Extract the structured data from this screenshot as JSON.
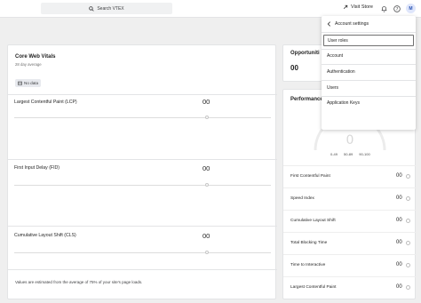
{
  "topbar": {
    "search_placeholder": "Search VTEX",
    "visit_store": "Visit Store",
    "avatar_initial": "M"
  },
  "core_web_vitals": {
    "title": "Core Web Vitals",
    "subtitle": "28 day average",
    "badge": "No data",
    "metrics": [
      {
        "label": "Largest Contentful Paint (LCP)",
        "value": "00",
        "level": 0.75
      },
      {
        "label": "First Input Delay (FID)",
        "value": "00",
        "level": 0.75
      },
      {
        "label": "Cumulative Layout Shift (CLS)",
        "value": "00",
        "level": 0.75
      }
    ],
    "footnote": "Values are estimated from the average of 75% of your site's page loads."
  },
  "opportunities": {
    "title": "Opportuniti",
    "value": "00"
  },
  "performance": {
    "title": "Performance",
    "gauge_value": "0",
    "gauge_labels": [
      "0-49",
      "50-89",
      "90-100"
    ],
    "rows": [
      {
        "label": "First Contentful Paint",
        "value": "00"
      },
      {
        "label": "Speed Index",
        "value": "00"
      },
      {
        "label": "Cumulative Layout Shift",
        "value": "00"
      },
      {
        "label": "Total Blocking Time",
        "value": "00"
      },
      {
        "label": "Time to Interactive",
        "value": "00"
      },
      {
        "label": "Largest Contentful Paint",
        "value": "00"
      }
    ]
  },
  "account_menu": {
    "header": "Account settings",
    "items": [
      "User roles",
      "Account",
      "Authentication",
      "Users",
      "Application Keys"
    ],
    "active_index": 0
  }
}
